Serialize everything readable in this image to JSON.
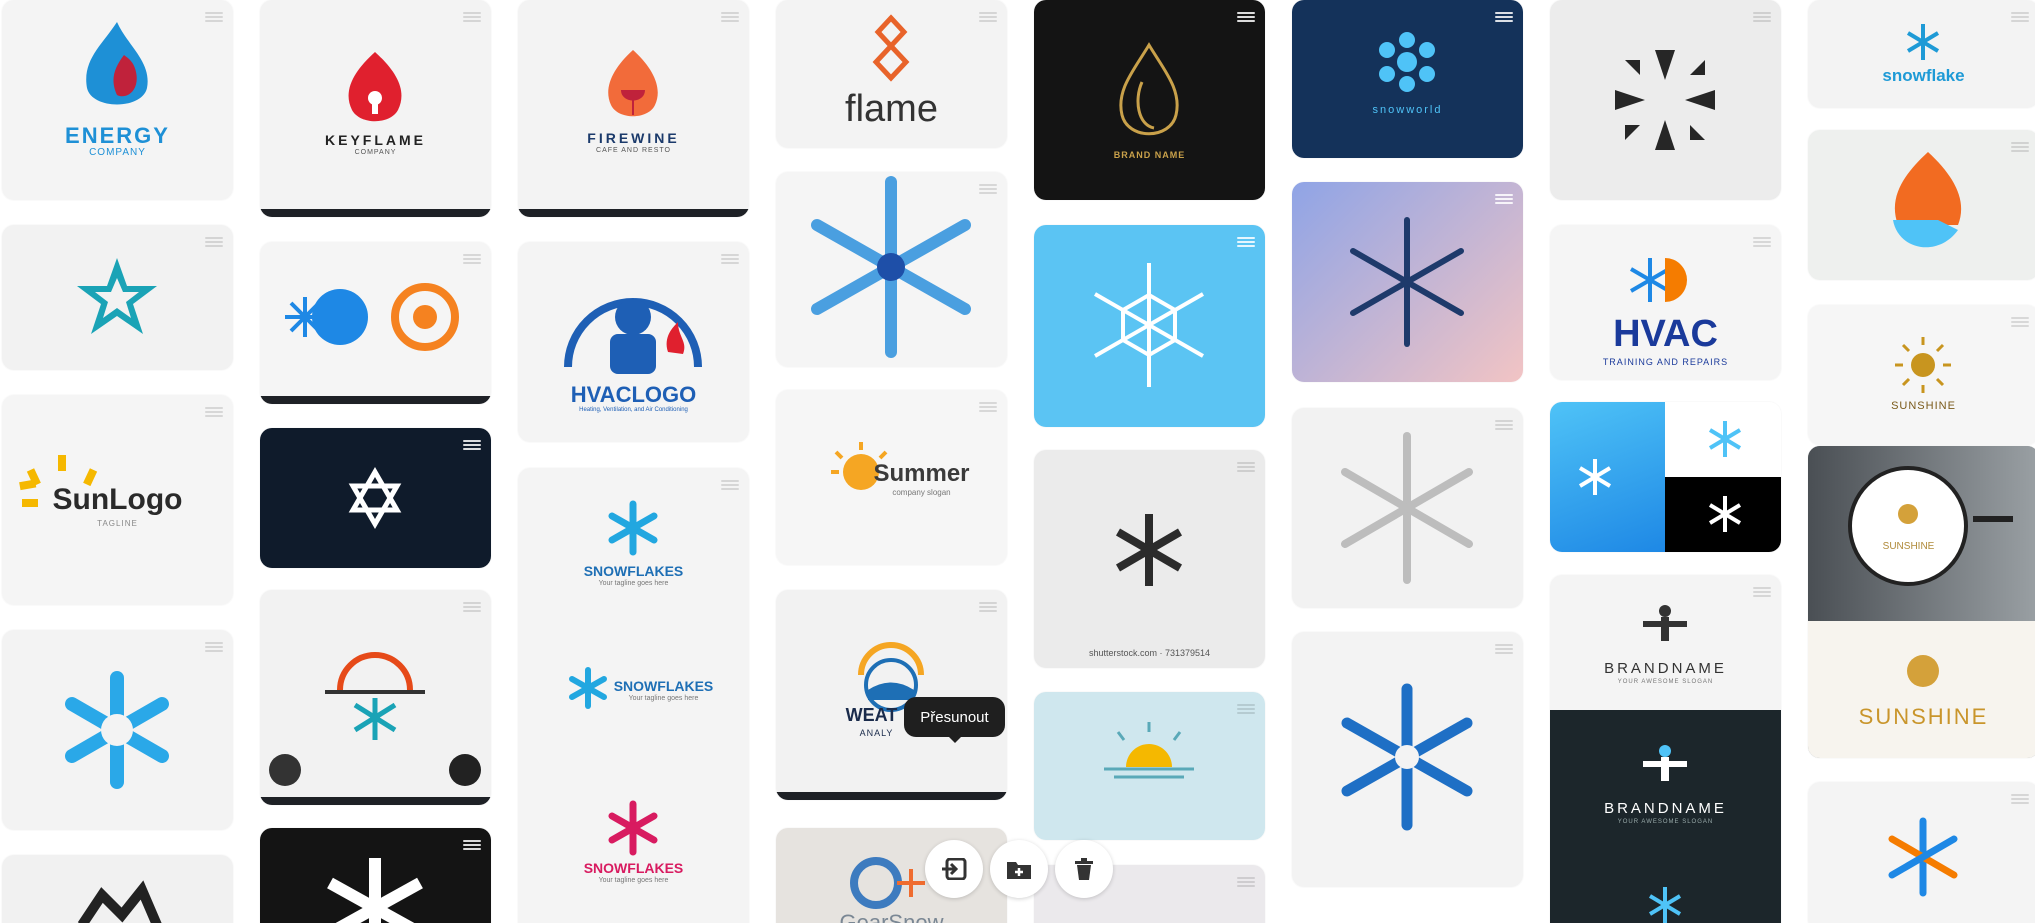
{
  "pins": {
    "energy": {
      "brand": "ENERGY",
      "sub": "COMPANY"
    },
    "keyflame": {
      "brand": "KEYFLAME",
      "sub": "COMPANY"
    },
    "firewine": {
      "brand": "FIREWINE",
      "sub": "CAFE AND RESTO"
    },
    "flame": {
      "brand": "flame"
    },
    "brandname_gold": {
      "brand": "BRAND NAME"
    },
    "snowworld": {
      "brand": "snowworld"
    },
    "snowflake": {
      "brand": "snowflake"
    },
    "sunlogo": {
      "brand": "SunLogo",
      "sub": "TAGLINE"
    },
    "hvaclogo": {
      "brand": "HVACLOGO",
      "sub": "Heating, Ventilation, and Air Conditioning"
    },
    "summer": {
      "brand": "Summer",
      "sub": "company slogan"
    },
    "hvac": {
      "brand": "HVAC",
      "sub": "TRAINING AND REPAIRS"
    },
    "sunshine_small": {
      "brand": "SUNSHINE"
    },
    "snowflakes_1": {
      "brand": "SNOWFLAKES",
      "sub": "Your tagline goes here"
    },
    "snowflakes_2": {
      "brand": "SNOWFLAKES",
      "sub": "Your tagline goes here"
    },
    "snowflakes_3": {
      "brand": "SNOWFLAKES",
      "sub": "Your tagline goes here"
    },
    "weather": {
      "brand": "WEAT",
      "sub": "ANALY"
    },
    "brandname_white": {
      "brand": "BRANDNAME",
      "sub": "YOUR AWESOME SLOGAN"
    },
    "brandname_dark": {
      "brand": "BRANDNAME",
      "sub": "YOUR AWESOME SLOGAN"
    },
    "sunshine_sign": {
      "brand": "SUNSHINE"
    },
    "sunshine_big": {
      "brand": "SUNSHINE"
    },
    "gearsnow": {
      "brand": "GearSnow"
    },
    "shutterstock": {
      "caption": "shutterstock.com · 731379514"
    }
  },
  "tooltip": {
    "text": "Přesunout"
  },
  "actions": {
    "move": "move-icon",
    "add": "add-to-board-icon",
    "delete": "trash-icon"
  },
  "colors": {
    "accent_blue": "#1e90d6",
    "flame_red": "#e63a2e",
    "sun_orange": "#f5a623",
    "dark_navy": "#0e1a2b"
  }
}
